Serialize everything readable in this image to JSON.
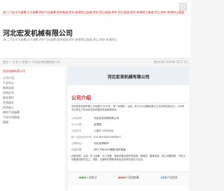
{
  "topbar": {
    "text": "阀门,汽化水冷烟罩,水冷烟罩,转炉汽化烟罩,转炉烟道,转炉,新建除尘烟道,转炉,除尘烟道,转炉,除尘烟道,转炉,新增除尘烟道,除尘,转炉,新增除尘烟道"
  },
  "header": {
    "company_name": "河北宏发机械有限公司",
    "subnav": "阀门,汽化水冷烟罩,水冷烟罩,转炉汽化烟罩,转炉烟道,转炉,新建除尘烟道,除尘,转炉,新增除尘"
  },
  "crumbs": {
    "left": "首页 > 企业 > 机械 > 河北宏发机械有限公司",
    "right": "营业时间 2024年 07月 2日"
  },
  "sidebar": {
    "heading": "宏发机械有限公司",
    "items": [
      "公司介绍",
      "产品中心",
      "新闻动态",
      "资质证书",
      "联系我们",
      "在线留言",
      "招贤纳士",
      "转炉汽化烟罩",
      "汽化冷却烟道",
      "烟道"
    ]
  },
  "main": {
    "banner_title": "河北宏发机械有限公司",
    "section_title": "公司介绍",
    "intro": "河北宏发机械有限公司创建于1992年，是一家钢铁、冶金、电力行业设备制造为主业的科技型企业，公司有专业的生产技术队伍和完善的质量管理体系。",
    "info": [
      {
        "label": "公司名称：",
        "value": "河北宏发机械有限公司"
      },
      {
        "label": "法人代表：",
        "value": "赵丽霞"
      },
      {
        "label": "注册资本：",
        "value": "人民币 1000万元"
      },
      {
        "label": "统一社会信用代码：",
        "value": "91130432601960097"
      },
      {
        "label": "注册地址：",
        "value": "河北省邯郸市"
      },
      {
        "label": "经营范围：",
        "value": "阀门,汽化水冷烟罩,转炉烟道"
      }
    ],
    "scope_text": "经营范围：冶金、矿山设备、化工设备、铸造设备及锅炉的制造；钢结构、管道安装、除尘设备制造、汽化冷却烟道及配件加工、销售；自营和代理各类商品及技术的进出口业务。",
    "stats": [
      {
        "num": "4000",
        "label": "人浏览过"
      },
      {
        "num": "8000",
        "label": "人添加收藏"
      },
      {
        "num": "15",
        "label": "条产品信息"
      }
    ]
  },
  "colors": {
    "accent": "#c0302a",
    "banner_bg": "#eaf0f5",
    "stat_green": "#2f7d2f"
  }
}
